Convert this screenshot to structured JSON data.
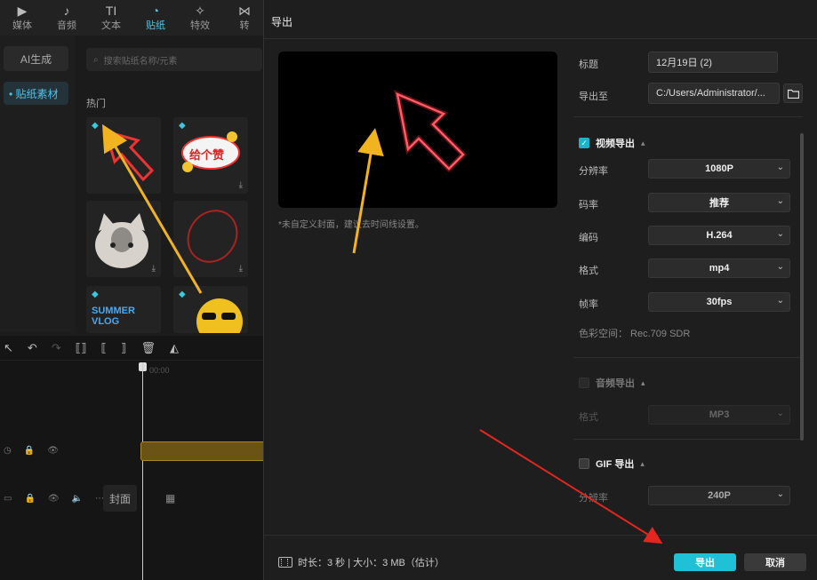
{
  "background_editor": {
    "top_tabs": [
      {
        "label": "媒体",
        "icon": "media-icon"
      },
      {
        "label": "音频",
        "icon": "audio-icon"
      },
      {
        "label": "文本",
        "icon": "text-icon"
      },
      {
        "label": "贴纸",
        "icon": "sticker-icon"
      },
      {
        "label": "特效",
        "icon": "effects-icon"
      },
      {
        "label": "转",
        "icon": "transition-icon"
      }
    ],
    "left_nav": {
      "ai_button": "AI生成",
      "sticker_material": "• 贴纸素材"
    },
    "sticker_panel": {
      "search_placeholder": "搜索贴纸名称/元素",
      "section_label": "热门",
      "stickers": [
        {
          "name": "neon-arrow-sticker"
        },
        {
          "name": "gei-ge-zan-sticker",
          "text": "给个赞"
        },
        {
          "name": "cat-sticker"
        },
        {
          "name": "red-circle-sticker"
        },
        {
          "name": "summer-vlog-sticker",
          "text": "SUMMER VLOG"
        },
        {
          "name": "sunglasses-emoji-sticker"
        }
      ]
    },
    "timeline": {
      "time_label": "00:00",
      "cover_label": "封面"
    }
  },
  "export_dialog": {
    "title": "导出",
    "preview_note": "*未自定义封面，建议去时间线设置。",
    "title_label": "标题",
    "title_value": "12月19日 (2)",
    "export_to_label": "导出至",
    "export_to_value": "C:/Users/Administrator/...",
    "video_section": {
      "label": "视频导出",
      "checked": true,
      "rows": [
        {
          "label": "分辨率",
          "value": "1080P"
        },
        {
          "label": "码率",
          "value": "推荐"
        },
        {
          "label": "编码",
          "value": "H.264"
        },
        {
          "label": "格式",
          "value": "mp4"
        },
        {
          "label": "帧率",
          "value": "30fps"
        }
      ],
      "color_space": "色彩空间： Rec.709 SDR"
    },
    "audio_section": {
      "label": "音频导出",
      "checked": false,
      "format_label": "格式",
      "format_value": "MP3"
    },
    "gif_section": {
      "label": "GIF 导出",
      "checked": false,
      "resolution_label": "分辨率",
      "resolution_value": "240P"
    },
    "footer": {
      "info": "时长：3 秒 | 大小：3 MB（估计）",
      "export_button": "导出",
      "cancel_button": "取消"
    }
  },
  "colors": {
    "accent": "#1ec1d6",
    "annotation_arrow_yellow": "#f2b321",
    "annotation_arrow_red": "#e3261f",
    "neon_red": "#ff2b3a"
  }
}
